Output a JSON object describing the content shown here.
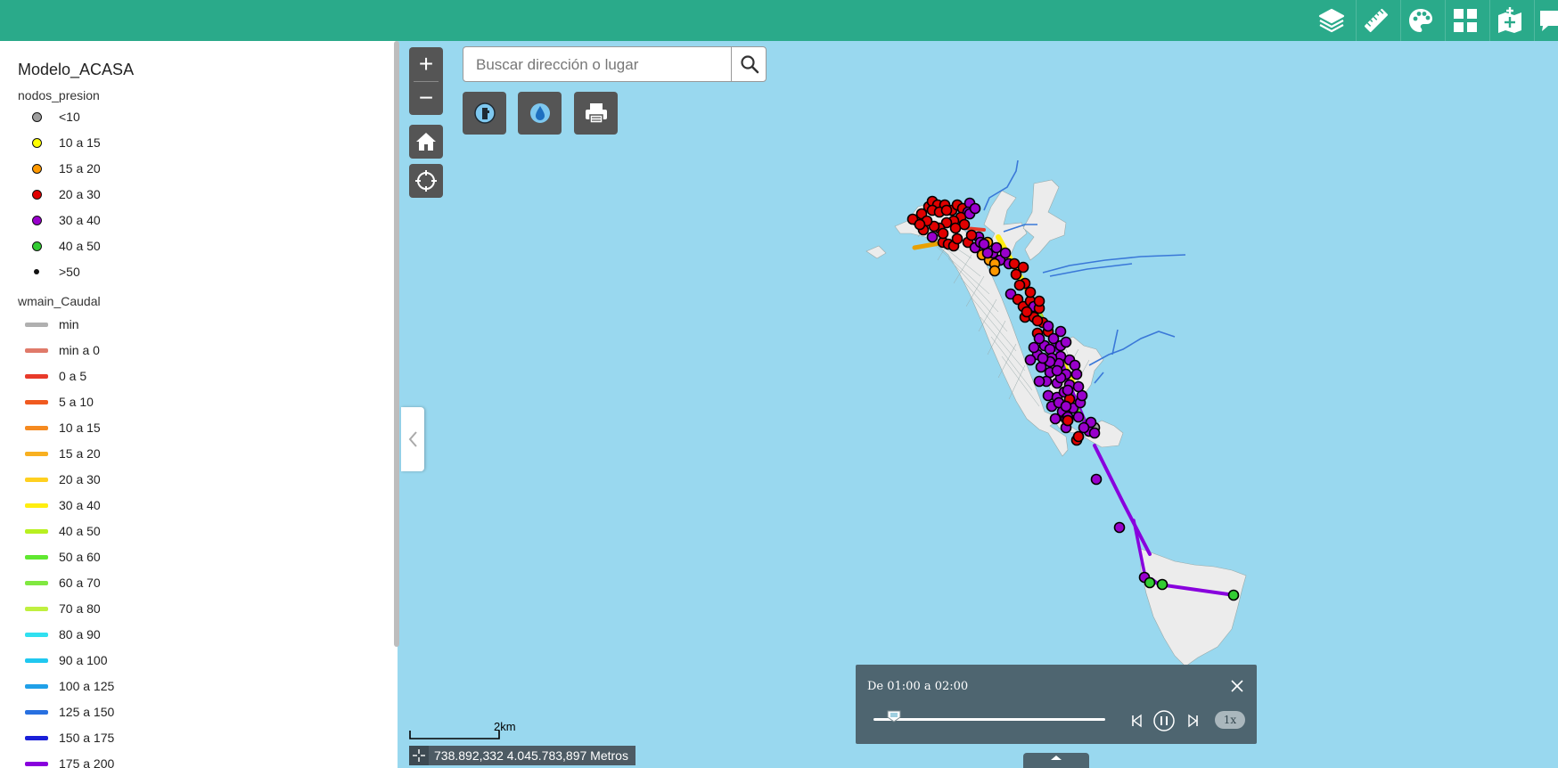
{
  "topbar": {
    "bg": "#2aaa8a",
    "icons": [
      "layers-icon",
      "ruler-icon",
      "palette-icon",
      "dashboard-icon",
      "add-map-icon",
      "chat-icon"
    ]
  },
  "legend": {
    "title": "Modelo_ACASA",
    "layers": [
      {
        "name": "nodos_presion",
        "items": [
          {
            "label": "<10",
            "color": "#9e9e9e",
            "sym": "dot"
          },
          {
            "label": "10 a 15",
            "color": "#ffff00",
            "sym": "dot"
          },
          {
            "label": "15 a 20",
            "color": "#ff9900",
            "sym": "dot"
          },
          {
            "label": "20 a 30",
            "color": "#e00000",
            "sym": "dot"
          },
          {
            "label": "30 a 40",
            "color": "#9900cc",
            "sym": "dot"
          },
          {
            "label": "40 a 50",
            "color": "#33cc33",
            "sym": "dot"
          },
          {
            "label": ">50",
            "color": "#111111",
            "sym": "small"
          }
        ]
      },
      {
        "name": "wmain_Caudal",
        "items": [
          {
            "label": "min",
            "color": "#b0b0b0",
            "sym": "line"
          },
          {
            "label": "min a 0",
            "color": "#e07a6a",
            "sym": "line"
          },
          {
            "label": "0 a 5",
            "color": "#e83a2a",
            "sym": "line"
          },
          {
            "label": "5 a 10",
            "color": "#f05a20",
            "sym": "line"
          },
          {
            "label": "10 a 15",
            "color": "#f58a20",
            "sym": "line"
          },
          {
            "label": "15 a 20",
            "color": "#f8b020",
            "sym": "line"
          },
          {
            "label": "20 a 30",
            "color": "#ffd020",
            "sym": "line"
          },
          {
            "label": "30 a 40",
            "color": "#ffee10",
            "sym": "line"
          },
          {
            "label": "40 a 50",
            "color": "#b8f020",
            "sym": "line"
          },
          {
            "label": "50 a 60",
            "color": "#60e830",
            "sym": "line"
          },
          {
            "label": "60 a 70",
            "color": "#80e840",
            "sym": "line"
          },
          {
            "label": "70 a 80",
            "color": "#c0f040",
            "sym": "line"
          },
          {
            "label": "80 a 90",
            "color": "#30e0f0",
            "sym": "line"
          },
          {
            "label": "90 a 100",
            "color": "#20c8f0",
            "sym": "line"
          },
          {
            "label": "100 a 125",
            "color": "#20a0e8",
            "sym": "line"
          },
          {
            "label": "125 a 150",
            "color": "#2870e0",
            "sym": "line"
          },
          {
            "label": "150 a 175",
            "color": "#1a20d8",
            "sym": "line"
          },
          {
            "label": "175 a 200",
            "color": "#8800dd",
            "sym": "line"
          }
        ]
      }
    ]
  },
  "search": {
    "placeholder": "Buscar dirección o lugar"
  },
  "scale": {
    "label": "2km"
  },
  "coords": {
    "text": "738.892,332 4.045.783,897 Metros"
  },
  "time_slider": {
    "label": "De 01:00 a 02:00",
    "speed": "1x",
    "progress": 0.05
  },
  "map": {
    "sea_color": "#99d8ef",
    "land_color": "#ececec"
  }
}
